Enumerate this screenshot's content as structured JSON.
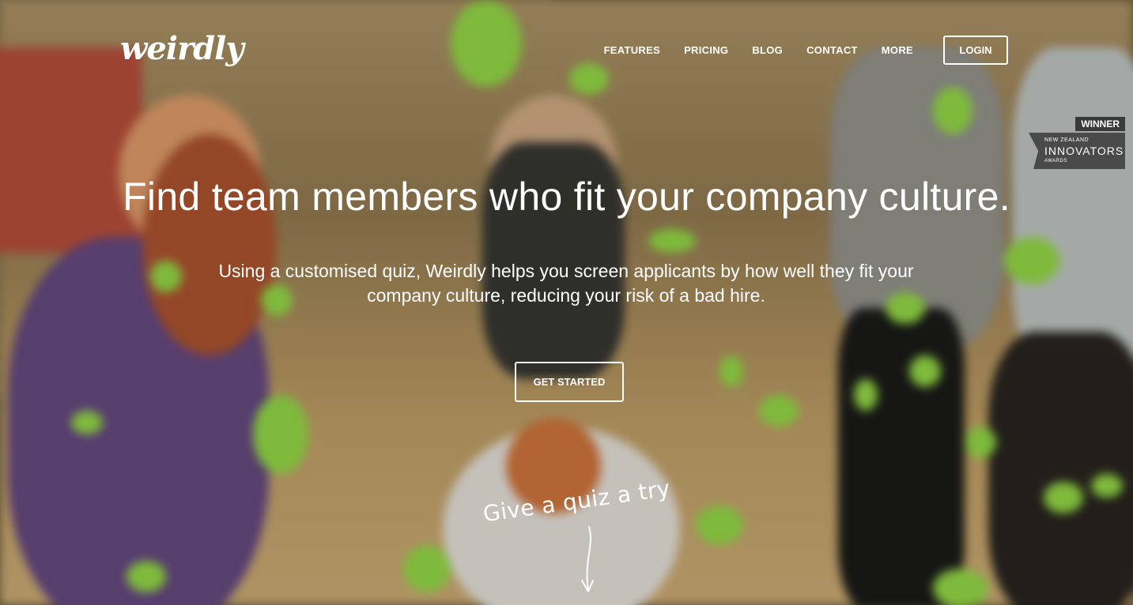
{
  "brand": {
    "logo_text": "weirdly"
  },
  "nav": {
    "items": [
      {
        "label": "FEATURES"
      },
      {
        "label": "PRICING"
      },
      {
        "label": "BLOG"
      },
      {
        "label": "CONTACT"
      },
      {
        "label": "MORE"
      }
    ],
    "login_label": "LOGIN"
  },
  "badge": {
    "winner": "WINNER",
    "region": "NEW ZEALAND",
    "name": "INNOVATORS",
    "awards": "AWARDS"
  },
  "hero": {
    "headline": "Find team members who fit your company culture.",
    "subtext": "Using a customised quiz, Weirdly helps you screen applicants by how well they fit your company culture, reducing your risk of a bad hire.",
    "cta_label": "GET STARTED",
    "quiz_prompt": "Give a quiz a try"
  },
  "colors": {
    "accent_green": "#9be34a",
    "text": "#ffffff"
  }
}
